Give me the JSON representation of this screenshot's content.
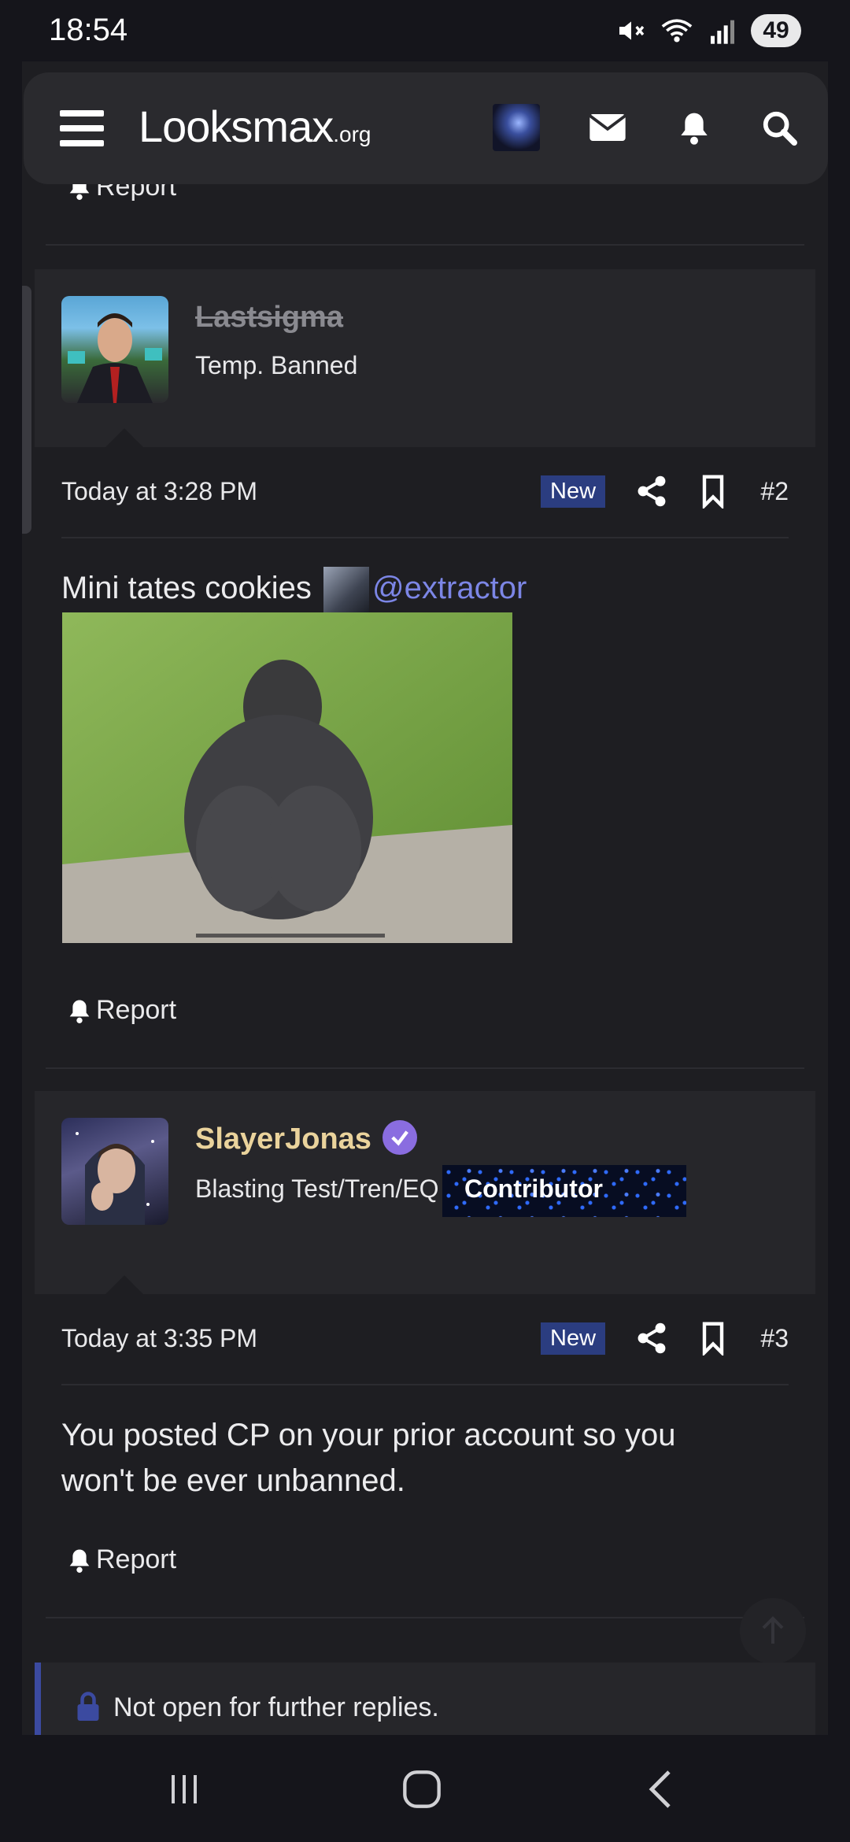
{
  "status_bar": {
    "time": "18:54",
    "battery": "49",
    "icons": [
      "mute-icon",
      "wifi-icon",
      "signal-icon"
    ]
  },
  "header": {
    "logo_main": "Looksmax",
    "logo_suffix": ".org",
    "icons": [
      "menu-icon",
      "avatar",
      "mail-icon",
      "bell-icon",
      "search-icon"
    ]
  },
  "prior_post": {
    "report_label": "Report"
  },
  "posts": [
    {
      "username": "Lastsigma",
      "user_title": "Temp. Banned",
      "date": "Today at 3:28 PM",
      "badge": "New",
      "number": "#2",
      "content_text": "Mini tates cookies",
      "mention": "@extractor",
      "report_label": "Report"
    },
    {
      "username": "SlayerJonas",
      "user_title": "Blasting Test/Tren/EQ",
      "user_banner": "Contributor",
      "date": "Today at 3:35 PM",
      "badge": "New",
      "number": "#3",
      "content_line1": "You posted CP on your prior account so you",
      "content_line2": "won't be ever unbanned.",
      "report_label": "Report"
    }
  ],
  "thread_status": "Not open for further replies.",
  "colors": {
    "background": "#1e1e22",
    "accent": "#2b3d80",
    "mention": "#7c86e6",
    "username_gold": "#ead39c"
  },
  "nav_bar": {
    "icons": [
      "recents-icon",
      "home-icon",
      "back-icon"
    ]
  }
}
